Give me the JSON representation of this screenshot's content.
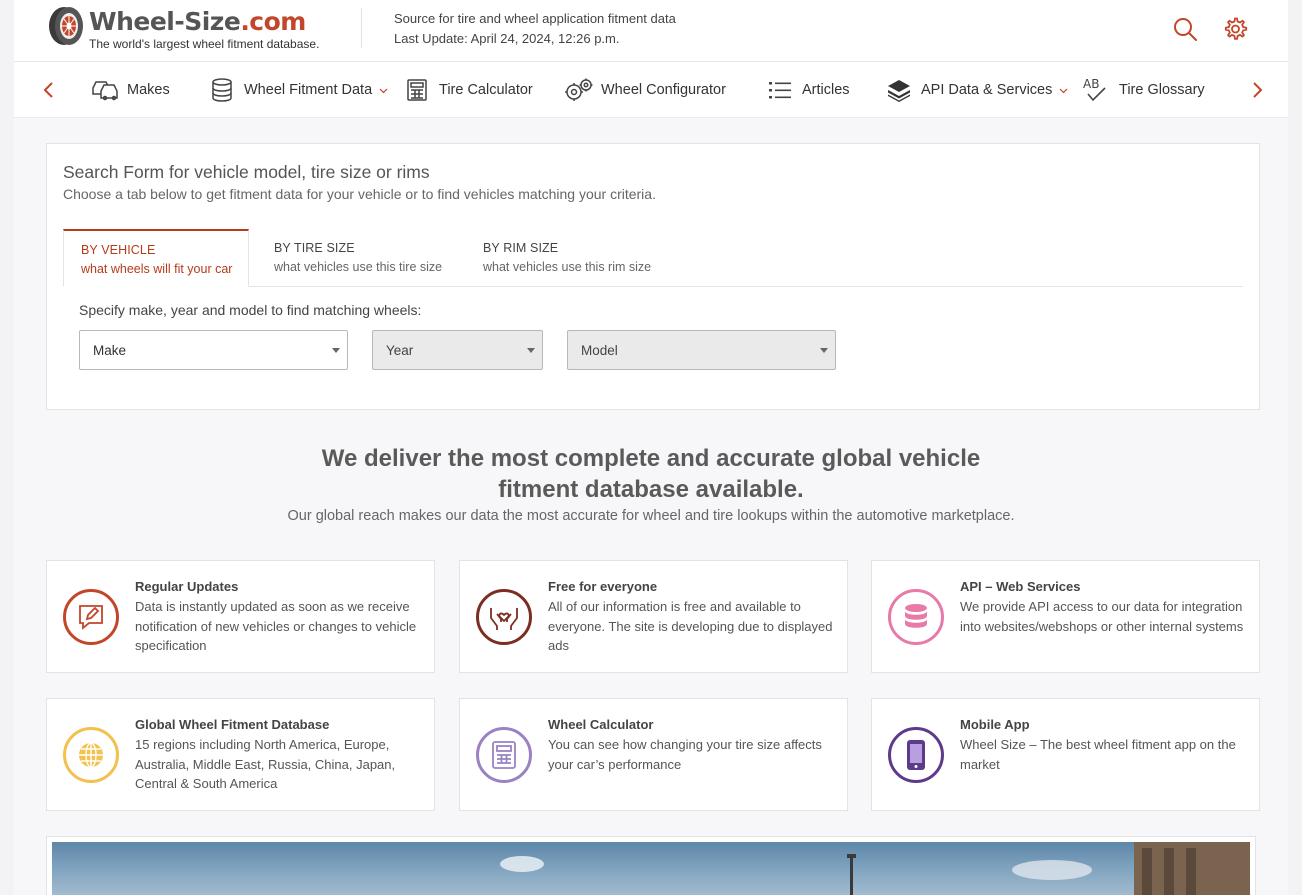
{
  "header": {
    "logo_title_main": "Wheel-Size",
    "logo_title_suffix": ".com",
    "logo_tagline": "The world's largest wheel fitment database.",
    "source_text": "Source for tire and wheel application fitment data",
    "last_update": "Last Update: April 24, 2024, 12:26 p.m.",
    "search_icon": "search-icon",
    "settings_icon": "gear-icon"
  },
  "nav": {
    "items": [
      {
        "label": "Makes",
        "icon": "cars-icon",
        "dropdown": false
      },
      {
        "label": "Wheel Fitment Data",
        "icon": "database-icon",
        "dropdown": true
      },
      {
        "label": "Tire Calculator",
        "icon": "calculator-icon",
        "dropdown": false
      },
      {
        "label": "Wheel Configurator",
        "icon": "gears-icon",
        "dropdown": false
      },
      {
        "label": "Articles",
        "icon": "list-icon",
        "dropdown": false
      },
      {
        "label": "API Data & Services",
        "icon": "layers-icon",
        "dropdown": true
      },
      {
        "label": "Tire Glossary",
        "icon": "ab-check-icon",
        "dropdown": false
      }
    ]
  },
  "search": {
    "title": "Search Form for vehicle model, tire size or rims",
    "subtitle": "Choose a tab below to get fitment data for your vehicle or to find vehicles matching your criteria.",
    "tabs": [
      {
        "label": "BY VEHICLE",
        "sub": "what wheels will fit your car",
        "active": true
      },
      {
        "label": "BY TIRE SIZE",
        "sub": "what vehicles use this tire size",
        "active": false
      },
      {
        "label": "BY RIM SIZE",
        "sub": "what vehicles use this rim size",
        "active": false
      }
    ],
    "instruction": "Specify make, year and model to find matching wheels:",
    "selects": [
      {
        "value": "Make",
        "disabled": false
      },
      {
        "value": "Year",
        "disabled": true
      },
      {
        "value": "Model",
        "disabled": true
      }
    ]
  },
  "hero": {
    "title": "We deliver the most complete and accurate global vehicle fitment database available.",
    "subtitle": "Our global reach makes our data the most accurate for wheel and tire lookups within the automotive marketplace."
  },
  "features": [
    {
      "title": "Regular Updates",
      "desc": "Data is instantly updated as soon as we receive notification of new vehicles or changes to vehicle specification",
      "icon": "edit-message-icon",
      "color": "#c2462a"
    },
    {
      "title": "Free for everyone",
      "desc": "All of our information is free and available to everyone. The site is developing due to displayed ads",
      "icon": "hands-heart-icon",
      "color": "#7a2f22"
    },
    {
      "title": "API – Web Services",
      "desc": "We provide API access to our data for integration into websites/webshops or other internal systems",
      "icon": "database-icon",
      "color": "#e87aa8"
    },
    {
      "title": "Global Wheel Fitment Database",
      "desc": "15 regions including North America, Europe, Australia, Middle East, Russia, China, Japan, Central & South America",
      "icon": "globe-icon",
      "color": "#f2c14e"
    },
    {
      "title": "Wheel Calculator",
      "desc": "You can see how changing your tire size affects your car’s performance",
      "icon": "calculator-icon",
      "color": "#9a82c4"
    },
    {
      "title": "Mobile App",
      "desc": "Wheel Size – The best wheel fitment app on the market",
      "icon": "smartphone-icon",
      "color": "#5d3a8a"
    }
  ]
}
